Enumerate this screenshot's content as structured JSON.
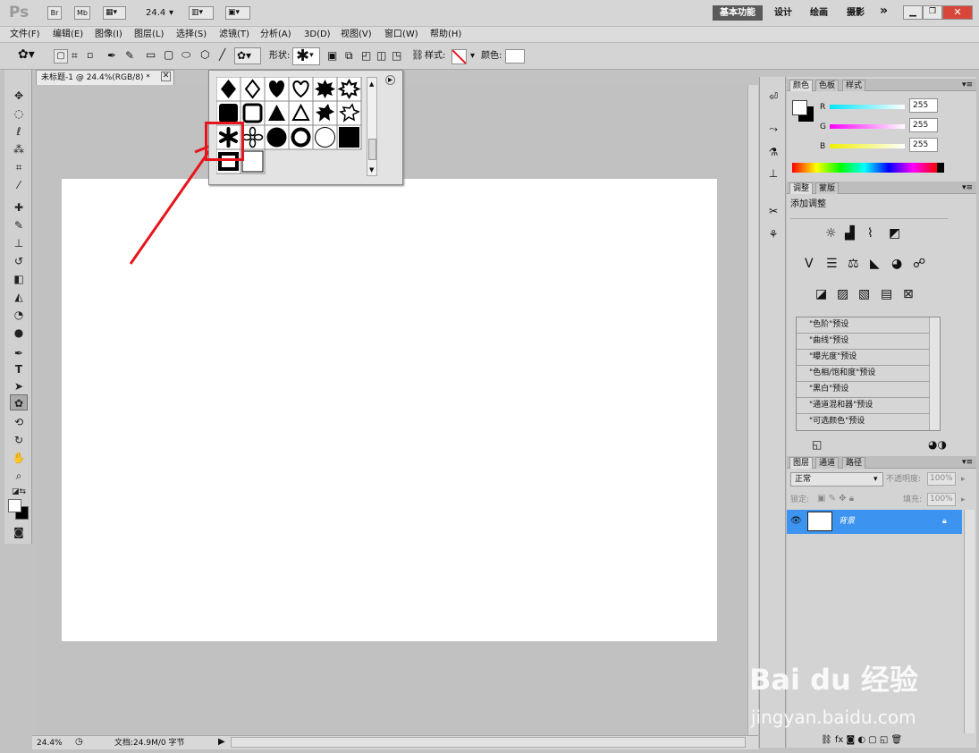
{
  "titlebar": {
    "logo": "Ps",
    "br_label": "Br",
    "mb_label": "Mb",
    "zoom_value": "24.4",
    "workspaces": [
      "基本功能",
      "设计",
      "绘画",
      "摄影"
    ],
    "more_label": "»"
  },
  "menu": [
    "文件(F)",
    "编辑(E)",
    "图像(I)",
    "图层(L)",
    "选择(S)",
    "滤镜(T)",
    "分析(A)",
    "3D(D)",
    "视图(V)",
    "窗口(W)",
    "帮助(H)"
  ],
  "options": {
    "shape_label": "形状:",
    "style_label": "样式:",
    "color_label": "颜色:"
  },
  "document": {
    "tab_title": "未标题-1 @ 24.4%(RGB/8) *",
    "status_zoom": "24.4%",
    "status_doc": "文档:24.9M/0 字节"
  },
  "color_panel": {
    "tabs": [
      "颜色",
      "色板",
      "样式"
    ],
    "channels": [
      {
        "label": "R",
        "value": "255",
        "color": "#00e5ff"
      },
      {
        "label": "G",
        "value": "255",
        "color": "#ff00ff"
      },
      {
        "label": "B",
        "value": "255",
        "color": "#f0f000"
      }
    ]
  },
  "adjust_panel": {
    "tabs": [
      "调整",
      "蒙版"
    ],
    "title": "添加调整",
    "presets": [
      "\"色阶\"预设",
      "\"曲线\"预设",
      "\"曝光度\"预设",
      "\"色相/饱和度\"预设",
      "\"黑白\"预设",
      "\"通道混和器\"预设",
      "\"可选颜色\"预设"
    ]
  },
  "layers_panel": {
    "tabs": [
      "图层",
      "通道",
      "路径"
    ],
    "blend_mode": "正常",
    "opacity_label": "不透明度:",
    "opacity_value": "100%",
    "lock_label": "锁定:",
    "fill_label": "填充:",
    "fill_value": "100%",
    "layer_name": "背景"
  },
  "shape_picker": {
    "shapes": [
      "diamond-filled",
      "diamond-outline",
      "heart-filled",
      "heart-outline",
      "seal-filled",
      "seal-outline",
      "square-filled",
      "square-frame",
      "triangle-filled",
      "triangle-outline",
      "blob-filled",
      "blob-outline",
      "asterisk",
      "flower-outline",
      "circle-filled",
      "circle-ring",
      "circle-outline",
      "square-black",
      "frame-thick",
      "square-white"
    ],
    "selected": "asterisk"
  },
  "watermark": {
    "brand": "Bai du 经验",
    "url": "jingyan.baidu.com"
  },
  "colors": {
    "highlight": "#e8141c",
    "layer_selected": "#3c94f0",
    "workspace_active": "#5a5a5a"
  }
}
